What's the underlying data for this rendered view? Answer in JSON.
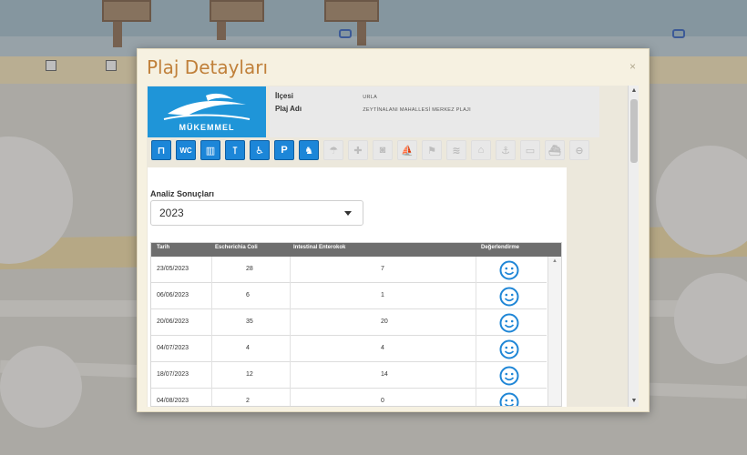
{
  "dialog": {
    "title": "Plaj Detayları",
    "close_label": "×"
  },
  "logo": {
    "text": "MÜKEMMEL",
    "icon": "swimmer-icon",
    "color": "#1f95d8"
  },
  "info": {
    "district_label": "İlçesi",
    "district_value": "URLA",
    "beach_label": "Plaj Adı",
    "beach_value": "ZEYTİNALANI MAHALLESİ MERKEZ PLAJI"
  },
  "facilities": [
    {
      "name": "shower-icon",
      "glyph": "⊓",
      "active": true
    },
    {
      "name": "wc-icon",
      "glyph": "WC",
      "active": true
    },
    {
      "name": "changing-cabin-icon",
      "glyph": "▥",
      "active": true
    },
    {
      "name": "lifeguard-tower-icon",
      "glyph": "⊺",
      "active": true
    },
    {
      "name": "wheelchair-icon",
      "glyph": "♿",
      "active": true
    },
    {
      "name": "parking-icon",
      "glyph": "P",
      "active": true
    },
    {
      "name": "pet-icon",
      "glyph": "♞",
      "active": true
    },
    {
      "name": "umbrella-icon",
      "glyph": "☂",
      "active": false
    },
    {
      "name": "first-aid-icon",
      "glyph": "✚",
      "active": false
    },
    {
      "name": "camera-icon",
      "glyph": "◙",
      "active": false
    },
    {
      "name": "sailing-icon",
      "glyph": "⛵",
      "active": false
    },
    {
      "name": "flag-icon",
      "glyph": "⚑",
      "active": false
    },
    {
      "name": "drinking-water-icon",
      "glyph": "≋",
      "active": false
    },
    {
      "name": "tent-icon",
      "glyph": "⌂",
      "active": false
    },
    {
      "name": "anchor-icon",
      "glyph": "⚓",
      "active": false
    },
    {
      "name": "bus-icon",
      "glyph": "▭",
      "active": false
    },
    {
      "name": "boat-icon",
      "glyph": "⛴",
      "active": false
    },
    {
      "name": "no-entry-icon",
      "glyph": "⊖",
      "active": false
    }
  ],
  "analysis": {
    "label": "Analiz Sonuçları",
    "selected_year": "2023"
  },
  "table": {
    "headers": [
      "Tarih",
      "Escherichia Coli",
      "Intestinal Enterokok",
      "Değerlendirme"
    ],
    "rows": [
      {
        "date": "23/05/2023",
        "ecoli": "28",
        "entero": "7",
        "rating": "smiley-icon"
      },
      {
        "date": "06/06/2023",
        "ecoli": "6",
        "entero": "1",
        "rating": "smiley-icon"
      },
      {
        "date": "20/06/2023",
        "ecoli": "35",
        "entero": "20",
        "rating": "smiley-icon"
      },
      {
        "date": "04/07/2023",
        "ecoli": "4",
        "entero": "4",
        "rating": "smiley-icon"
      },
      {
        "date": "18/07/2023",
        "ecoli": "12",
        "entero": "14",
        "rating": "smiley-icon"
      },
      {
        "date": "04/08/2023",
        "ecoli": "2",
        "entero": "0",
        "rating": "smiley-icon"
      }
    ]
  }
}
